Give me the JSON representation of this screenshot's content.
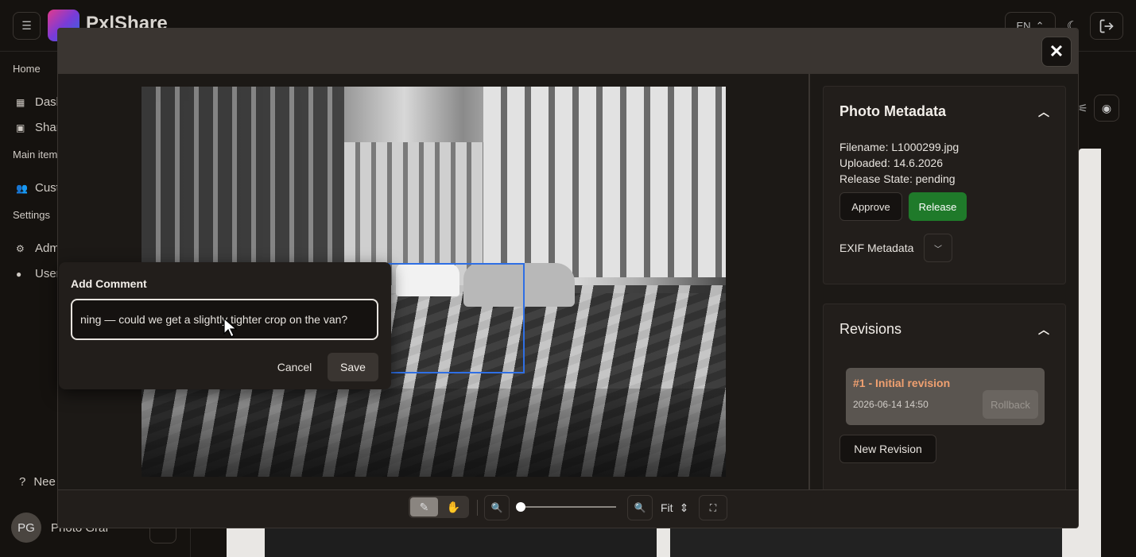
{
  "app": {
    "name": "PxlShare",
    "language": "EN"
  },
  "sidebar": {
    "groups": [
      {
        "label": "Home",
        "items": [
          {
            "label": "Dash"
          },
          {
            "label": "Shar"
          }
        ]
      },
      {
        "label": "Main item",
        "items": [
          {
            "label": "Cust"
          }
        ]
      },
      {
        "label": "Settings",
        "items": [
          {
            "label": "Adm"
          },
          {
            "label": "User"
          }
        ]
      }
    ],
    "help_label": "Nee",
    "user": {
      "initials": "PG",
      "name": "Photo Graf"
    }
  },
  "modal": {
    "close_icon": "close-icon",
    "metadata": {
      "title": "Photo Metadata",
      "filename": "Filename: L1000299.jpg",
      "uploaded": "Uploaded: 14.6.2026",
      "release_state": "Release State: pending",
      "approve_label": "Approve",
      "release_label": "Release",
      "exif_label": "EXIF Metadata"
    },
    "revisions": {
      "title": "Revisions",
      "items": [
        {
          "title": "#1 - Initial revision",
          "date": "2026-06-14 14:50",
          "rollback_label": "Rollback"
        }
      ],
      "new_revision_label": "New Revision"
    },
    "toolbar": {
      "fit_label": "Fit",
      "zoom_level": 0
    }
  },
  "comment": {
    "title": "Add Comment",
    "value": "ning — could we get a slightly tighter crop on the van?",
    "cancel_label": "Cancel",
    "save_label": "Save"
  },
  "colors": {
    "accent_release": "#1f7a2a",
    "selection": "#2f6fe4",
    "revision_title": "#f0a070"
  }
}
